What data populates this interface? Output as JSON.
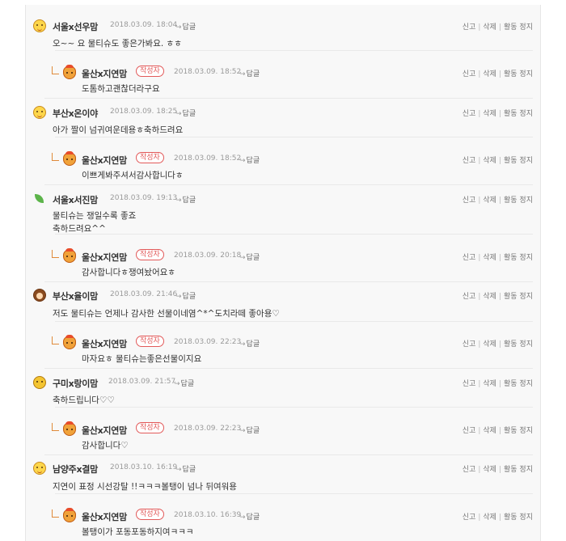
{
  "reply_label": "답글",
  "author_badge": "작성자",
  "actions": {
    "report": "신고",
    "delete": "삭제",
    "stop": "활동 정지"
  },
  "comments": [
    {
      "nick": "서울x선우맘",
      "date": "2018.03.09. 18:04",
      "text": "오~~ 요 물티슈도 좋은가봐요. ㅎㅎ"
    },
    {
      "nick": "울산x지연맘",
      "date": "2018.03.09. 18:52",
      "text": "도톰하고괜찮더라구요"
    },
    {
      "nick": "부산x온이야",
      "date": "2018.03.09. 18:25",
      "text": "아가 짤이 넘귀여운데용ㅎ축하드려요"
    },
    {
      "nick": "울산x지연맘",
      "date": "2018.03.09. 18:52",
      "text": "이쁘게봐주셔서감사합니다ㅎ"
    },
    {
      "nick": "서울x서진맘",
      "date": "2018.03.09. 19:13",
      "text": "물티슈는 쟁일수록 좋죠\n축하드려요^^"
    },
    {
      "nick": "울산x지연맘",
      "date": "2018.03.09. 20:18",
      "text": "감사합니다ㅎ쟁여놨어요ㅎ"
    },
    {
      "nick": "부산x율이맘",
      "date": "2018.03.09. 21:46",
      "text": "저도 물티슈는 언제나 감사한 선물이네염^*^도치라떼 좋아용♡"
    },
    {
      "nick": "울산x지연맘",
      "date": "2018.03.09. 22:23",
      "text": "마자요ㅎ 물티슈는좋은선물이지요"
    },
    {
      "nick": "구미x랑이맘",
      "date": "2018.03.09. 21:57",
      "text": "축하드립니다♡♡"
    },
    {
      "nick": "울산x지연맘",
      "date": "2018.03.09. 22:23",
      "text": "감사합니다♡"
    },
    {
      "nick": "남양주x결맘",
      "date": "2018.03.10. 16:19",
      "text": "지연이 표정 시선강탈 !!ㅋㅋㅋ볼탱이 넘나 뒤여워용"
    },
    {
      "nick": "울산x지연맘",
      "date": "2018.03.10. 16:39",
      "text": "볼탱이가 포동포동하지여ㅋㅋㅋ"
    }
  ]
}
